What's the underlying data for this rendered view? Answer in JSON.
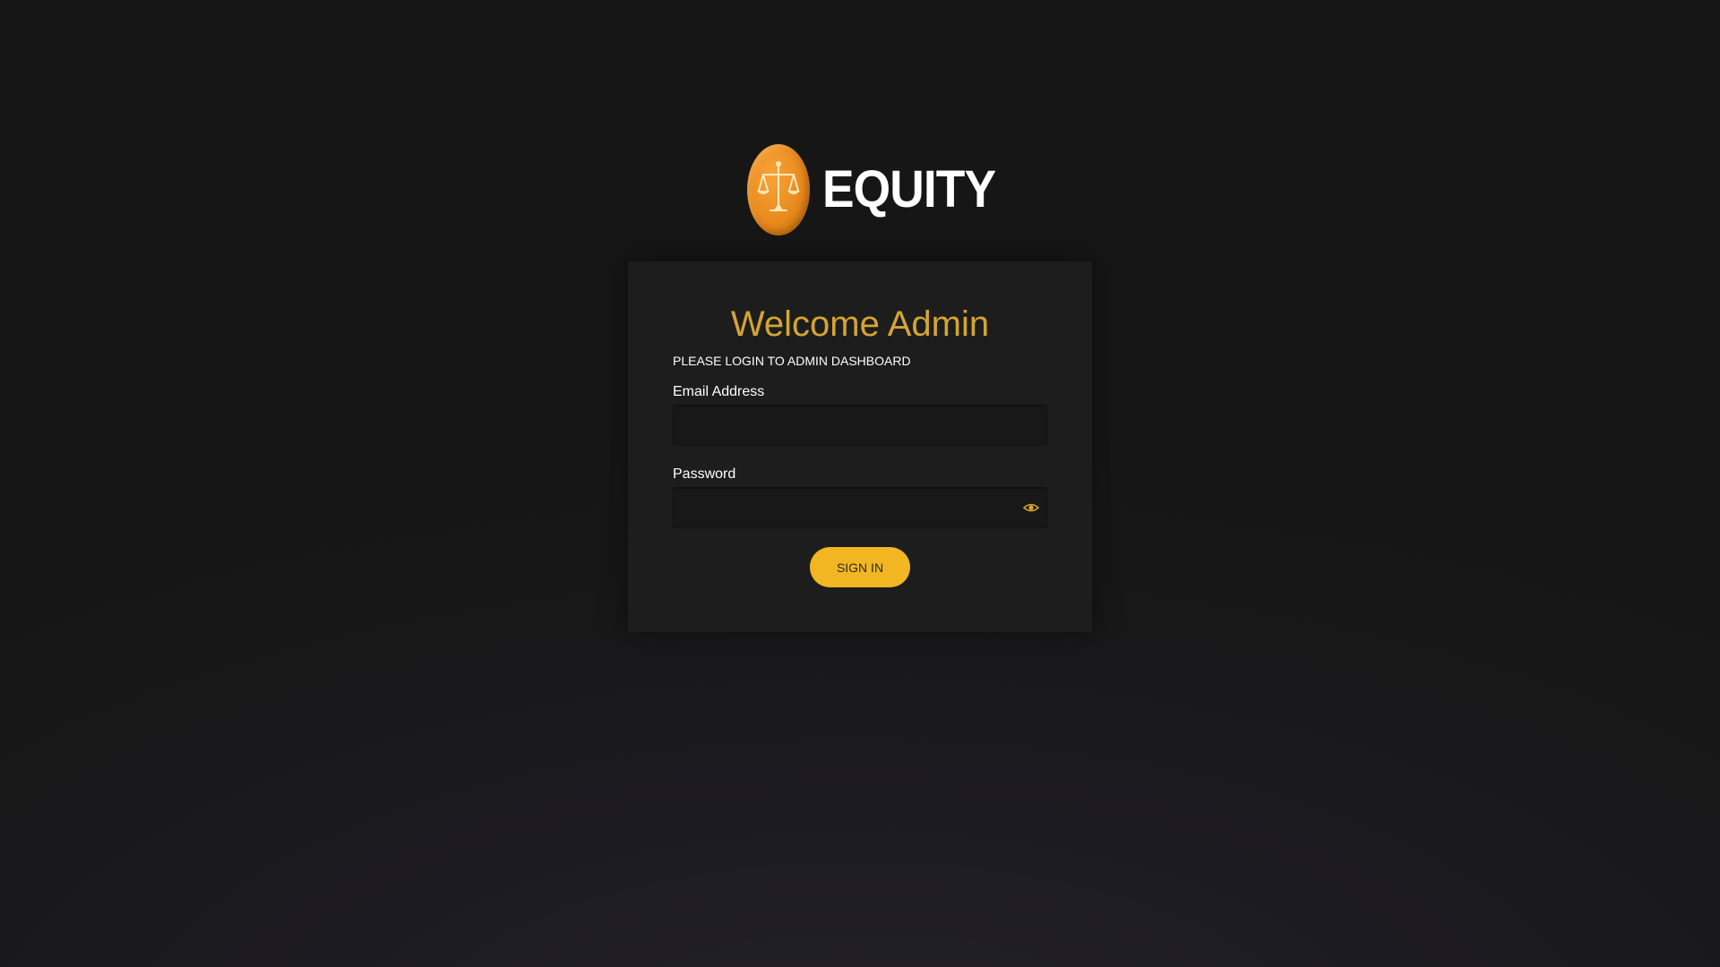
{
  "brand": {
    "name": "EQUITY",
    "accent_color": "#f2b623",
    "coin_color": "#e98a1e",
    "coin_icon": "scales-icon"
  },
  "login": {
    "title": "Welcome Admin",
    "subtitle": "PLEASE LOGIN TO ADMIN DASHBOARD",
    "email_label": "Email Address",
    "email_value": "",
    "password_label": "Password",
    "password_value": "",
    "password_toggle_icon": "eye-icon",
    "submit_label": "SIGN IN"
  },
  "colors": {
    "title": "#d4a532",
    "card_background": "#1d1d1d",
    "page_background": "#161616"
  }
}
